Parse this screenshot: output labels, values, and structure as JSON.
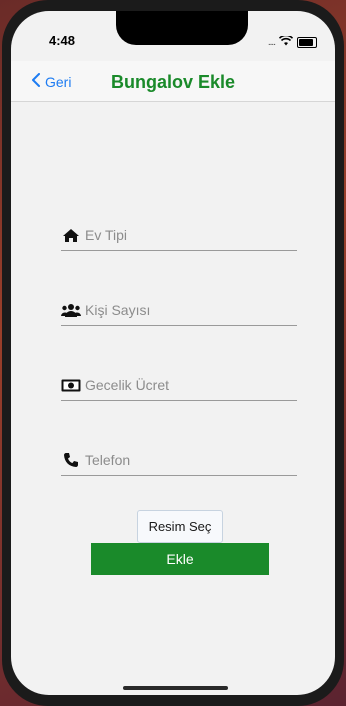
{
  "status": {
    "time": "4:48",
    "dots": "....",
    "wifi_icon": "wifi-icon",
    "battery_icon": "battery-icon"
  },
  "nav": {
    "back_label": "Geri",
    "title": "Bungalov Ekle",
    "accent": "#1a8a2a",
    "link_color": "#1e7cf2"
  },
  "form": {
    "fields": [
      {
        "icon": "house-icon",
        "placeholder": "Ev Tipi"
      },
      {
        "icon": "users-icon",
        "placeholder": "Kişi Sayısı"
      },
      {
        "icon": "money-icon",
        "placeholder": "Gecelik Ücret"
      },
      {
        "icon": "phone-icon",
        "placeholder": "Telefon"
      }
    ],
    "pick_image_label": "Resim Seç",
    "submit_label": "Ekle"
  }
}
